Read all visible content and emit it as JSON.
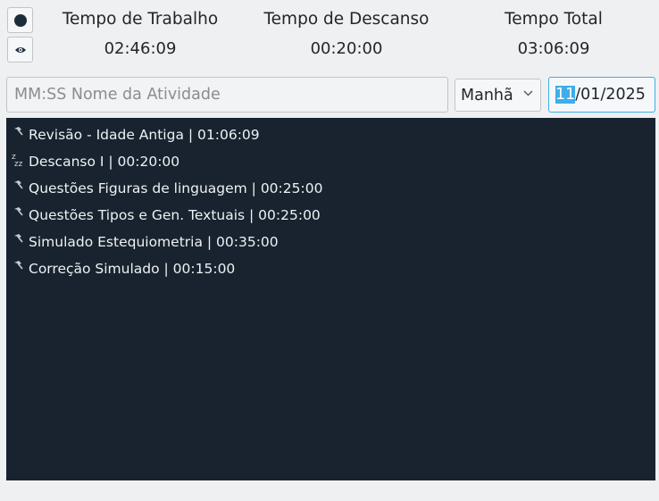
{
  "stats": {
    "work": {
      "title": "Tempo de Trabalho",
      "value": "02:46:09"
    },
    "rest": {
      "title": "Tempo de Descanso",
      "value": "00:20:00"
    },
    "total": {
      "title": "Tempo Total",
      "value": "03:06:09"
    }
  },
  "side_buttons": [
    {
      "icon": "record-icon"
    },
    {
      "icon": "eye-icon"
    }
  ],
  "form": {
    "activity_placeholder": "MM:SS Nome da Atividade",
    "period_value": "Manhã",
    "date_day": "11",
    "date_rest": "/01/2025"
  },
  "activities": [
    {
      "type": "work",
      "icon": "hammer-icon",
      "text": "Revisão - Idade Antiga | 01:06:09"
    },
    {
      "type": "rest",
      "icon": "sleep-icon",
      "text": "Descanso I | 00:20:00"
    },
    {
      "type": "work",
      "icon": "hammer-icon",
      "text": "Questões Figuras de linguagem | 00:25:00"
    },
    {
      "type": "work",
      "icon": "hammer-icon",
      "text": "Questões Tipos e Gen. Textuais | 00:25:00"
    },
    {
      "type": "work",
      "icon": "hammer-icon",
      "text": "Simulado Estequiometria | 00:35:00"
    },
    {
      "type": "work",
      "icon": "hammer-icon",
      "text": "Correção Simulado | 00:15:00"
    }
  ],
  "colors": {
    "list_background": "#18232f",
    "accent": "#3daee9",
    "window_background": "#eff0f1"
  }
}
